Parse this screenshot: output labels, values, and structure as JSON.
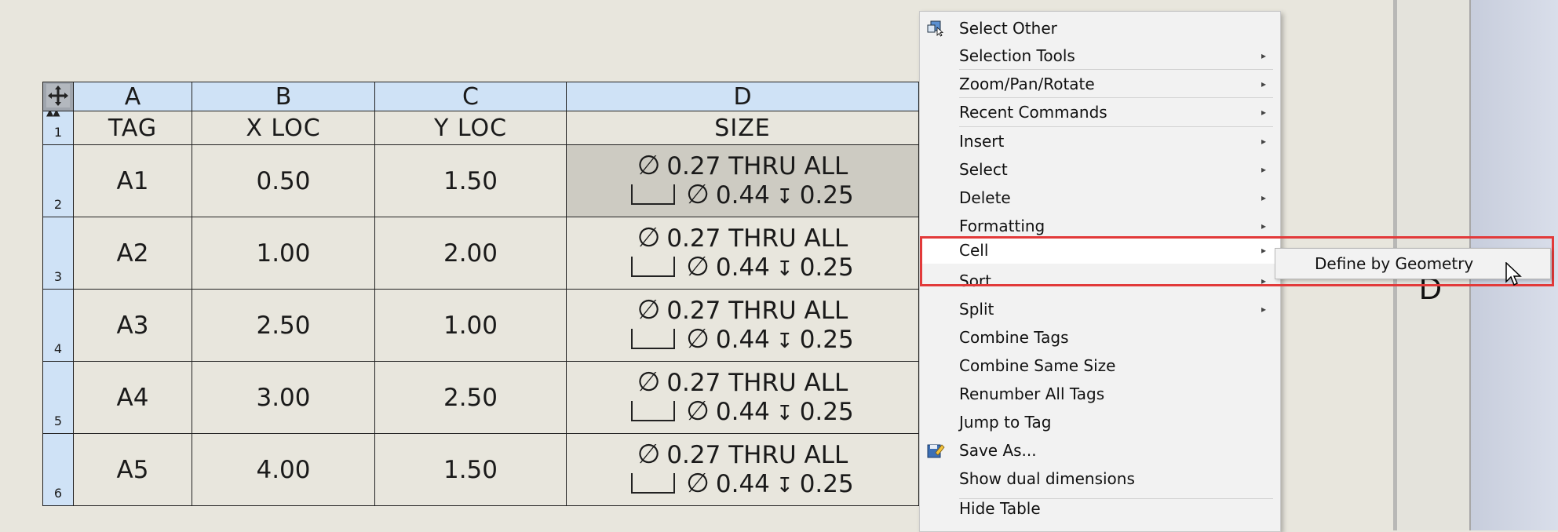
{
  "table": {
    "column_letters": [
      "A",
      "B",
      "C",
      "D"
    ],
    "header_row_number": "1",
    "headers": [
      "TAG",
      "X LOC",
      "Y LOC",
      "SIZE"
    ],
    "rows": [
      {
        "num": "2",
        "tag": "A1",
        "x": "0.50",
        "y": "1.50",
        "size_line1": "0.27 THRU ALL",
        "size_dia": "0.44",
        "size_depth": "0.25"
      },
      {
        "num": "3",
        "tag": "A2",
        "x": "1.00",
        "y": "2.00",
        "size_line1": "0.27 THRU ALL",
        "size_dia": "0.44",
        "size_depth": "0.25"
      },
      {
        "num": "4",
        "tag": "A3",
        "x": "2.50",
        "y": "1.00",
        "size_line1": "0.27 THRU ALL",
        "size_dia": "0.44",
        "size_depth": "0.25"
      },
      {
        "num": "5",
        "tag": "A4",
        "x": "3.00",
        "y": "2.50",
        "size_line1": "0.27 THRU ALL",
        "size_dia": "0.44",
        "size_depth": "0.25"
      },
      {
        "num": "6",
        "tag": "A5",
        "x": "4.00",
        "y": "1.50",
        "size_line1": "0.27 THRU ALL",
        "size_dia": "0.44",
        "size_depth": "0.25"
      }
    ],
    "selected_cell": "D2"
  },
  "symbols": {
    "diameter": "∅",
    "depth": "↧"
  },
  "context_menu": {
    "items": [
      {
        "label": "Select Other",
        "icon": "select-other-icon",
        "submenu": false
      },
      {
        "label": "Selection Tools",
        "submenu": true
      },
      {
        "label": "Zoom/Pan/Rotate",
        "submenu": true
      },
      {
        "label": "Recent Commands",
        "submenu": true
      },
      {
        "label": "Insert",
        "submenu": true
      },
      {
        "label": "Select",
        "submenu": true
      },
      {
        "label": "Delete",
        "submenu": true
      },
      {
        "label": "Formatting",
        "submenu": true
      },
      {
        "label": "Cell",
        "submenu": true,
        "hover": true
      },
      {
        "label": "Sort",
        "submenu": true
      },
      {
        "label": "Split",
        "submenu": true
      },
      {
        "label": "Combine Tags",
        "submenu": false
      },
      {
        "label": "Combine Same Size",
        "submenu": false
      },
      {
        "label": "Renumber All Tags",
        "submenu": false
      },
      {
        "label": "Jump to Tag",
        "submenu": false
      },
      {
        "label": "Save As...",
        "icon": "save-as-icon",
        "submenu": false
      },
      {
        "label": "Show dual dimensions",
        "submenu": false
      },
      {
        "label": "Hide Table",
        "submenu": false
      }
    ],
    "arrow_glyph": "▸"
  },
  "submenu": {
    "item": "Define by Geometry"
  },
  "background": {
    "stray_letter": "D"
  },
  "colors": {
    "highlight": "#e23a3a",
    "header_blue": "#cfe2f6",
    "selected_cell": "#cdcbc2"
  }
}
